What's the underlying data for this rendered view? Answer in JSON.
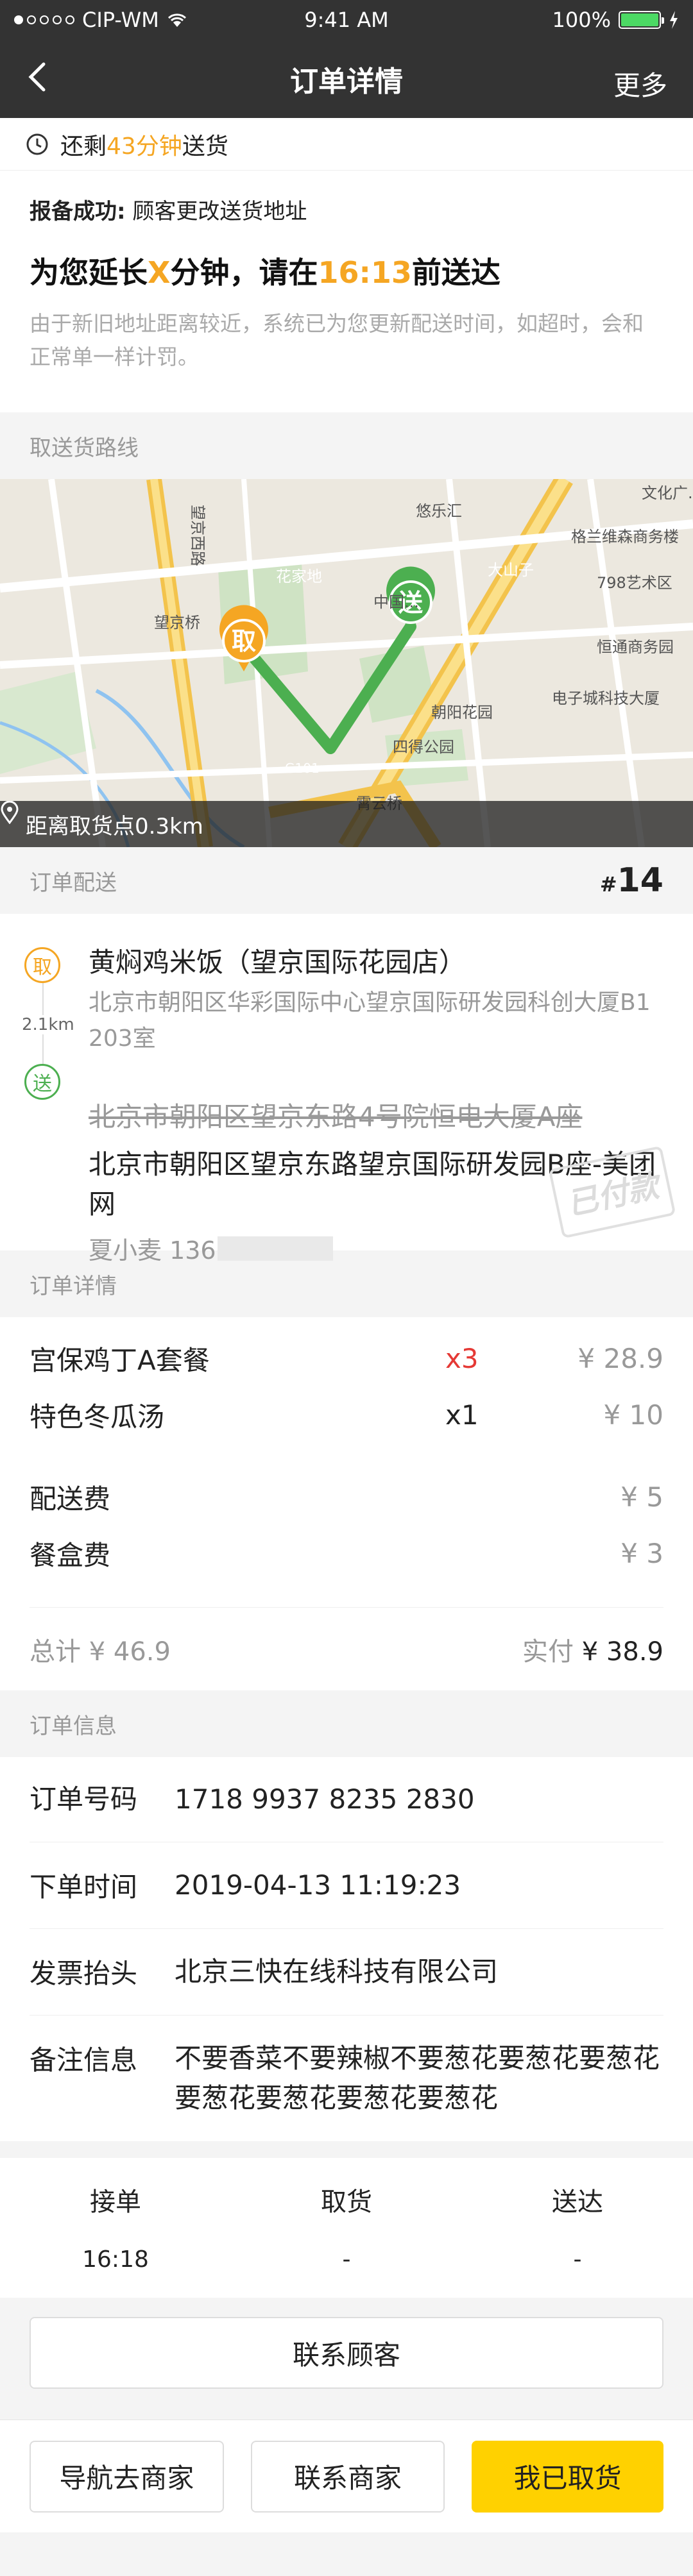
{
  "status_bar": {
    "carrier": "CIP-WM",
    "time": "9:41 AM",
    "battery": "100%"
  },
  "nav": {
    "title": "订单详情",
    "more": "更多"
  },
  "timer": {
    "prefix": "还剩",
    "minutes": "43分钟",
    "suffix": "送货"
  },
  "notice": {
    "label": "报备成功:",
    "reason": "顾客更改送货地址",
    "headline_pre": "为您延长",
    "headline_x": "X",
    "headline_mid": "分钟，请在",
    "headline_time": "16:13",
    "headline_post": "前送达",
    "description": "由于新旧地址距离较近，系统已为您更新配送时间，如超时，会和正常单一样计罚。"
  },
  "route_section": {
    "title": "取送货路线"
  },
  "map": {
    "footer": "距离取货点0.3km",
    "pickup_marker": "取",
    "deliver_marker": "送",
    "labels": [
      "望京西路",
      "花家地",
      "望京桥",
      "悠乐汇",
      "格兰维森商务楼",
      "798艺术区",
      "恒通商务园",
      "电子城科技大厦",
      "朝阳花园",
      "四得公园",
      "霄云桥",
      "大山子",
      "G101",
      "中国...",
      "文化广..."
    ]
  },
  "order_delivery": {
    "title": "订单配送",
    "number_prefix": "#",
    "number": "14"
  },
  "pickup": {
    "badge": "取",
    "name": "黄焖鸡米饭（望京国际花园店）",
    "address": "北京市朝阳区华彩国际中心望京国际研发园科创大厦B1 203室",
    "distance": "2.1km"
  },
  "dropoff": {
    "badge": "送",
    "old_address": "北京市朝阳区望京东路4号院恒电大厦A座",
    "new_address": "北京市朝阳区望京东路望京国际研发园B座-美团网",
    "customer": "夏小麦 136",
    "stamp": "已付款"
  },
  "order_details": {
    "title": "订单详情",
    "items": [
      {
        "name": "宫保鸡丁A套餐",
        "qty": "x3",
        "price": "¥ 28.9"
      },
      {
        "name": "特色冬瓜汤",
        "qty": "x1",
        "price": "¥ 10"
      }
    ],
    "fees": [
      {
        "name": "配送费",
        "price": "¥ 5"
      },
      {
        "name": "餐盒费",
        "price": "¥ 3"
      }
    ],
    "total_label": "总计 ¥ 46.9",
    "paid_label": "实付",
    "paid_value": "¥ 38.9"
  },
  "order_info": {
    "title": "订单信息",
    "rows": [
      {
        "label": "订单号码",
        "value": "1718 9937 8235 2830"
      },
      {
        "label": "下单时间",
        "value": "2019-04-13 11:19:23"
      },
      {
        "label": "发票抬头",
        "value": "北京三快在线科技有限公司"
      },
      {
        "label": "备注信息",
        "value": "不要香菜不要辣椒不要葱花要葱花要葱花要葱花要葱花要葱花要葱花"
      }
    ]
  },
  "progress": [
    {
      "step": "接单",
      "time": "16:18"
    },
    {
      "step": "取货",
      "time": "-"
    },
    {
      "step": "送达",
      "time": "-"
    }
  ],
  "buttons": {
    "contact_customer": "联系顾客",
    "navigate_merchant": "导航去商家",
    "contact_merchant": "联系商家",
    "picked_up": "我已取货"
  },
  "colors": {
    "accent": "#f5a623",
    "primary_button": "#ffd100",
    "route_green": "#4caf50",
    "header_bg": "#333333"
  }
}
